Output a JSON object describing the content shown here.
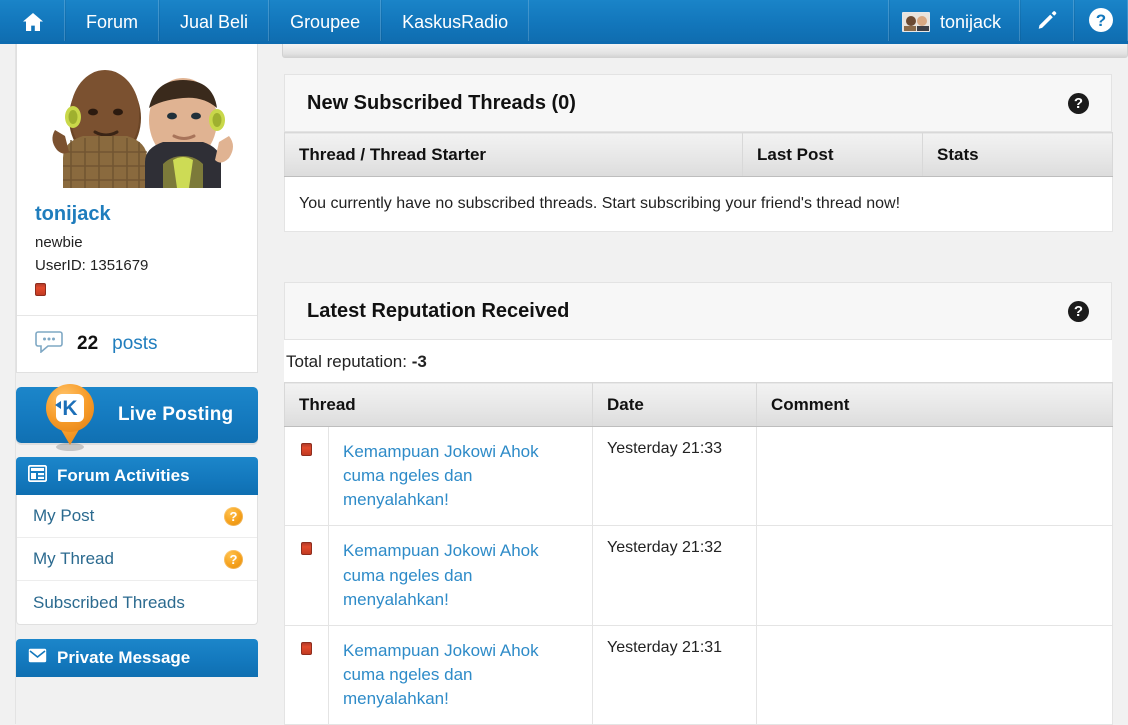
{
  "nav": {
    "home_icon": "home-icon",
    "items": [
      {
        "label": "Forum"
      },
      {
        "label": "Jual Beli"
      },
      {
        "label": "Groupee"
      },
      {
        "label": "KaskusRadio"
      }
    ],
    "username": "tonijack",
    "avatar_icon": "user-avatar",
    "edit_icon": "pencil-icon",
    "help_icon": "help-circle-icon"
  },
  "sidebar": {
    "profile": {
      "avatar_icon": "profile-photo",
      "name": "tonijack",
      "rank": "newbie",
      "userid": "UserID: 1351679",
      "reputation_icon": "red-reputation-square",
      "posts_icon": "comment-bubble-icon",
      "posts_count": "22",
      "posts_label": "posts"
    },
    "live_posting": {
      "label": "Live Posting",
      "icon": "kaskus-pin-icon"
    },
    "forum_activities": {
      "title": "Forum Activities",
      "icon": "layout-grid-icon",
      "items": [
        {
          "label": "My Post",
          "badge": "?"
        },
        {
          "label": "My Thread",
          "badge": "?"
        },
        {
          "label": "Subscribed Threads",
          "badge": ""
        }
      ]
    },
    "private_message": {
      "title": "Private Message",
      "icon": "envelope-icon"
    }
  },
  "main": {
    "subscribed": {
      "title": "New Subscribed Threads (0)",
      "help_icon": "help-circle-icon",
      "columns": [
        "Thread / Thread Starter",
        "Last Post",
        "Stats"
      ],
      "empty_message": "You currently have no subscribed threads. Start subscribing your friend's thread now!"
    },
    "reputation": {
      "title": "Latest Reputation Received",
      "help_icon": "help-circle-icon",
      "total_label": "Total reputation:",
      "total_value": "-3",
      "columns": [
        "Thread",
        "Date",
        "Comment"
      ],
      "rows": [
        {
          "icon": "red-reputation-square",
          "thread": "Kemampuan Jokowi Ahok cuma ngeles dan menyalahkan!",
          "date": "Yesterday 21:33",
          "comment": ""
        },
        {
          "icon": "red-reputation-square",
          "thread": "Kemampuan Jokowi Ahok cuma ngeles dan menyalahkan!",
          "date": "Yesterday 21:32",
          "comment": ""
        },
        {
          "icon": "red-reputation-square",
          "thread": "Kemampuan Jokowi Ahok cuma ngeles dan menyalahkan!",
          "date": "Yesterday 21:31",
          "comment": ""
        }
      ]
    }
  },
  "colors": {
    "brand_blue": "#1378bd",
    "link_blue": "#2e8bc8",
    "badge_orange": "#f5a01b",
    "rep_red": "#d6452a",
    "page_bg": "#f1f1f1"
  }
}
